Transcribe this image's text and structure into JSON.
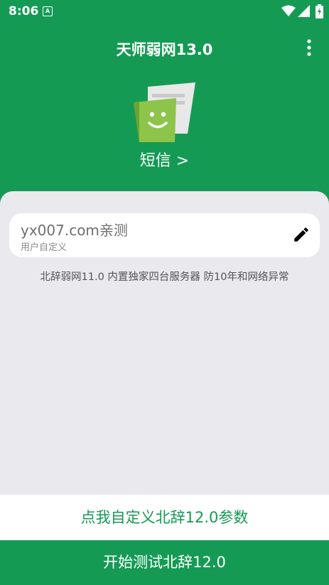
{
  "status_bar": {
    "time": "8:06",
    "a_icon_label": "A"
  },
  "app_bar": {
    "title": "天师弱网13.0"
  },
  "header": {
    "app_name": "短信 >"
  },
  "config_field": {
    "value": "yx007.com亲测",
    "label": "用户自定义"
  },
  "description": "北辞弱网11.0 内置独家四台服务器 防10年和网络异常",
  "buttons": {
    "customize": "点我自定义北辞12.0参数",
    "start_test": "开始测试北辞12.0"
  },
  "colors": {
    "brand_green": "#159a54",
    "background": "#e9e9ee",
    "icon_green": "#8dc44a"
  }
}
